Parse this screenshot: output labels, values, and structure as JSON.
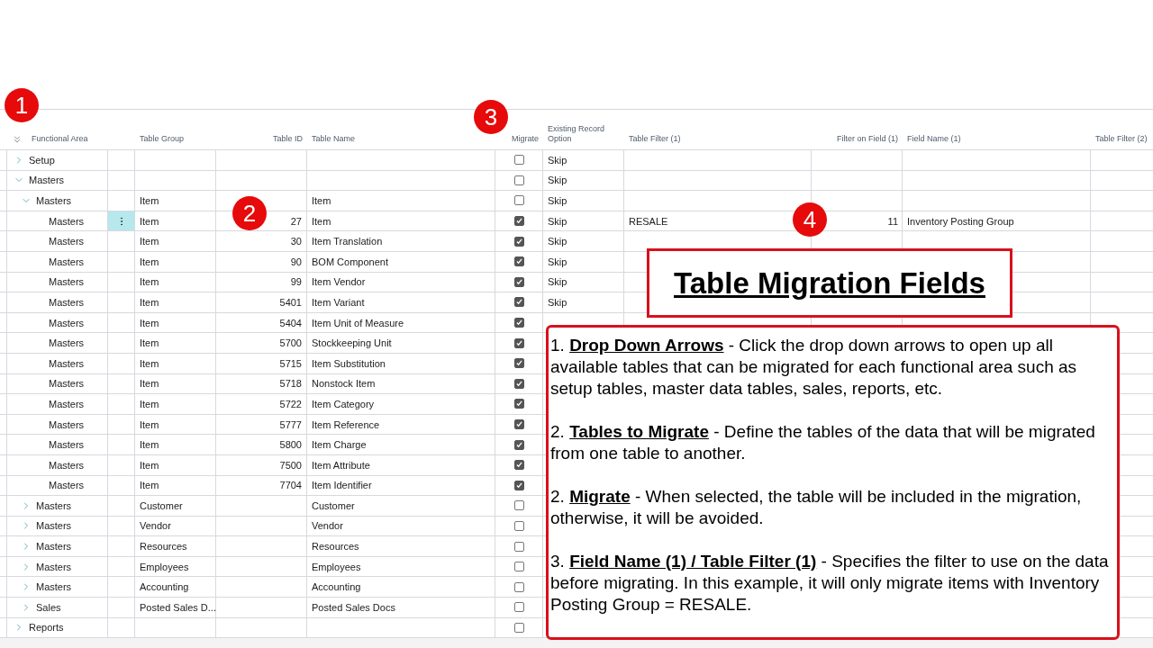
{
  "columns": [
    {
      "label": "Functional Area"
    },
    {
      "label": "Table Group"
    },
    {
      "label": "Table ID"
    },
    {
      "label": "Table Name"
    },
    {
      "label": "Migrate"
    },
    {
      "label": "Existing Record Option"
    },
    {
      "label": "Table Filter (1)"
    },
    {
      "label": "Filter on Field (1)"
    },
    {
      "label": "Field Name (1)"
    },
    {
      "label": "Table Filter (2)"
    }
  ],
  "rows": [
    {
      "area": "Setup",
      "expanded": false,
      "selected": false,
      "migrate": false,
      "option": "Skip"
    },
    {
      "area": "Masters",
      "expanded": true,
      "selected": false,
      "migrate": false,
      "option": "Skip",
      "children": [
        {
          "area": "Masters",
          "group": "Item",
          "table_name": "Item",
          "expanded": true,
          "selected": false,
          "migrate": false,
          "option": "Skip",
          "children": [
            {
              "area": "Masters",
              "group": "Item",
              "table_id": "27",
              "table_name": "Item",
              "selected": true,
              "migrate": true,
              "option": "Skip",
              "filter": "RESALE",
              "filter_field": "11",
              "field_name": "Inventory Posting Group"
            },
            {
              "area": "Masters",
              "group": "Item",
              "table_id": "30",
              "table_name": "Item Translation",
              "selected": false,
              "migrate": true,
              "option": "Skip"
            },
            {
              "area": "Masters",
              "group": "Item",
              "table_id": "90",
              "table_name": "BOM Component",
              "selected": false,
              "migrate": true,
              "option": "Skip"
            },
            {
              "area": "Masters",
              "group": "Item",
              "table_id": "99",
              "table_name": "Item Vendor",
              "selected": false,
              "migrate": true,
              "option": "Skip"
            },
            {
              "area": "Masters",
              "group": "Item",
              "table_id": "5401",
              "table_name": "Item Variant",
              "selected": false,
              "migrate": true,
              "option": "Skip"
            },
            {
              "area": "Masters",
              "group": "Item",
              "table_id": "5404",
              "table_name": "Item Unit of Measure",
              "selected": false,
              "migrate": true
            },
            {
              "area": "Masters",
              "group": "Item",
              "table_id": "5700",
              "table_name": "Stockkeeping Unit",
              "selected": false,
              "migrate": true
            },
            {
              "area": "Masters",
              "group": "Item",
              "table_id": "5715",
              "table_name": "Item Substitution",
              "selected": false,
              "migrate": true
            },
            {
              "area": "Masters",
              "group": "Item",
              "table_id": "5718",
              "table_name": "Nonstock Item",
              "selected": false,
              "migrate": true
            },
            {
              "area": "Masters",
              "group": "Item",
              "table_id": "5722",
              "table_name": "Item Category",
              "selected": false,
              "migrate": true
            },
            {
              "area": "Masters",
              "group": "Item",
              "table_id": "5777",
              "table_name": "Item Reference",
              "selected": false,
              "migrate": true
            },
            {
              "area": "Masters",
              "group": "Item",
              "table_id": "5800",
              "table_name": "Item Charge",
              "selected": false,
              "migrate": true
            },
            {
              "area": "Masters",
              "group": "Item",
              "table_id": "7500",
              "table_name": "Item Attribute",
              "selected": false,
              "migrate": true
            },
            {
              "area": "Masters",
              "group": "Item",
              "table_id": "7704",
              "table_name": "Item Identifier",
              "selected": false,
              "migrate": true
            }
          ]
        },
        {
          "area": "Masters",
          "group": "Customer",
          "table_name": "Customer",
          "expanded": false,
          "selected": false,
          "migrate": false
        },
        {
          "area": "Masters",
          "group": "Vendor",
          "table_name": "Vendor",
          "expanded": false,
          "selected": false,
          "migrate": false
        },
        {
          "area": "Masters",
          "group": "Resources",
          "table_name": "Resources",
          "expanded": false,
          "selected": false,
          "migrate": false
        },
        {
          "area": "Masters",
          "group": "Employees",
          "table_name": "Employees",
          "expanded": false,
          "selected": false,
          "migrate": false
        },
        {
          "area": "Masters",
          "group": "Accounting",
          "table_name": "Accounting",
          "expanded": false,
          "selected": false,
          "migrate": false
        },
        {
          "area": "Sales",
          "group": "Posted Sales D...",
          "table_name": "Posted Sales Docs",
          "expanded": false,
          "selected": false,
          "migrate": false
        }
      ]
    },
    {
      "area": "Reports",
      "expanded": false,
      "selected": false,
      "migrate": false
    }
  ],
  "callout_title": "Table Migration Fields",
  "callout_paragraphs": [
    "1. **Drop Down Arrows** - Click the drop down arrows to open up all available tables that can be migrated for each functional area such as setup tables, master data tables, sales, reports, etc.",
    "2. **Tables to Migrate** - Define the tables of the data that will be migrated from one table to another.",
    "2. **Migrate** - When selected, the table will be included in the migration, otherwise, it will be avoided.",
    "3. **Field Name (1) / Table Filter (1)** - Specifies the filter to use on the data before migrating. In this example, it will only migrate items with Inventory Posting Group = RESALE."
  ],
  "badges": [
    "1",
    "2",
    "3",
    "4"
  ]
}
